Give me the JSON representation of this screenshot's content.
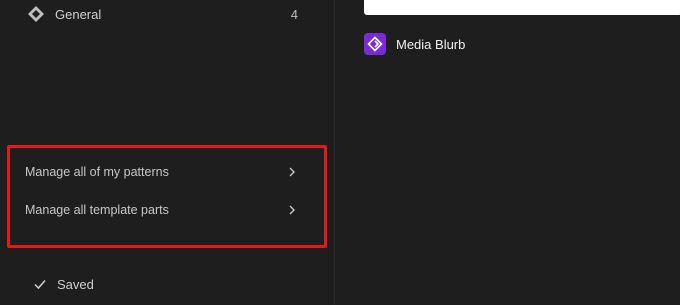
{
  "sidebar": {
    "nav_item": {
      "label": "General",
      "count": "4",
      "icon": "pattern-diamond-icon"
    },
    "manage_links": [
      {
        "label": "Manage all of my patterns",
        "icon": "chevron-right-icon"
      },
      {
        "label": "Manage all template parts",
        "icon": "chevron-right-icon"
      }
    ],
    "status": {
      "label": "Saved",
      "icon": "check-icon"
    }
  },
  "main": {
    "pattern": {
      "title": "Media Blurb",
      "icon": "pattern-block-icon"
    }
  },
  "colors": {
    "background": "#1e1e1e",
    "highlight_border": "#e11b1b",
    "pattern_icon_bg": "#7b2bd6",
    "preview_bg": "#ffffff"
  }
}
